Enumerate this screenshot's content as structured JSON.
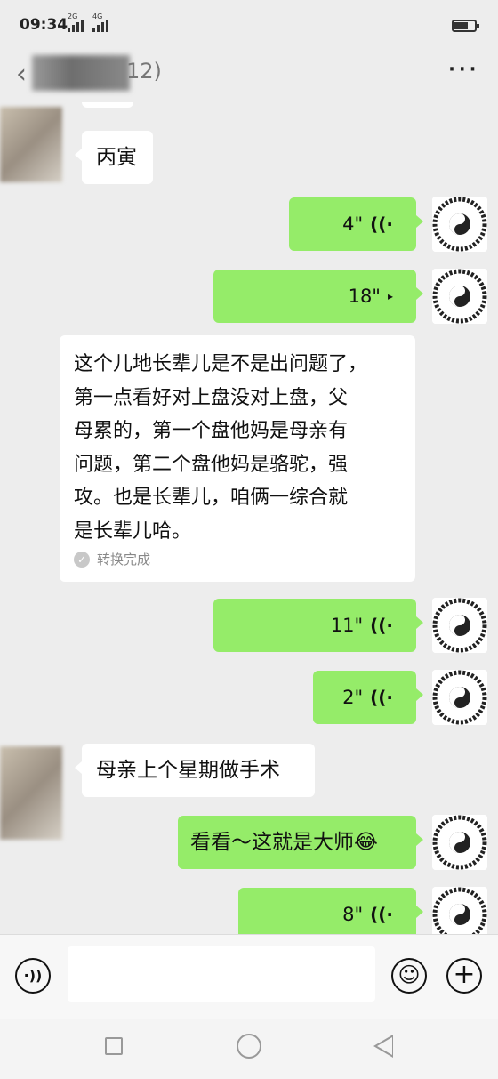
{
  "status_bar": {
    "time": "09:34",
    "net1": "2G",
    "net2": "4G"
  },
  "header": {
    "back_icon": "chevron-left-icon",
    "title_visible_suffix": "12)",
    "more_icon": "more-icon"
  },
  "messages": [
    {
      "side": "them",
      "type": "text",
      "text": "丙寅"
    },
    {
      "side": "me",
      "type": "voice",
      "duration": "4\""
    },
    {
      "side": "me",
      "type": "voice",
      "duration": "18\""
    },
    {
      "side": "me",
      "type": "transcript",
      "lines": [
        "这个儿地长辈儿是不是出问题了，",
        "第一点看好对上盘没对上盘，父",
        "母累的，第一个盘他妈是母亲有",
        "问题，第二个盘他妈是骆驼，强",
        "攻。也是长辈儿，咱俩一综合就",
        "是长辈儿哈。"
      ],
      "status": "转换完成"
    },
    {
      "side": "me",
      "type": "voice",
      "duration": "11\""
    },
    {
      "side": "me",
      "type": "voice",
      "duration": "2\""
    },
    {
      "side": "them",
      "type": "text",
      "text": "母亲上个星期做手术"
    },
    {
      "side": "me",
      "type": "text",
      "text": "看看～这就是大师",
      "emoji": "😂"
    },
    {
      "side": "me",
      "type": "voice",
      "duration": "8\""
    }
  ],
  "input_bar": {
    "voice_icon": "voice-input-icon",
    "emoji_icon": "emoji-icon",
    "plus_icon": "plus-icon"
  },
  "colors": {
    "bubble_me": "#95ec69",
    "bubble_them": "#ffffff",
    "background": "#ededed"
  }
}
